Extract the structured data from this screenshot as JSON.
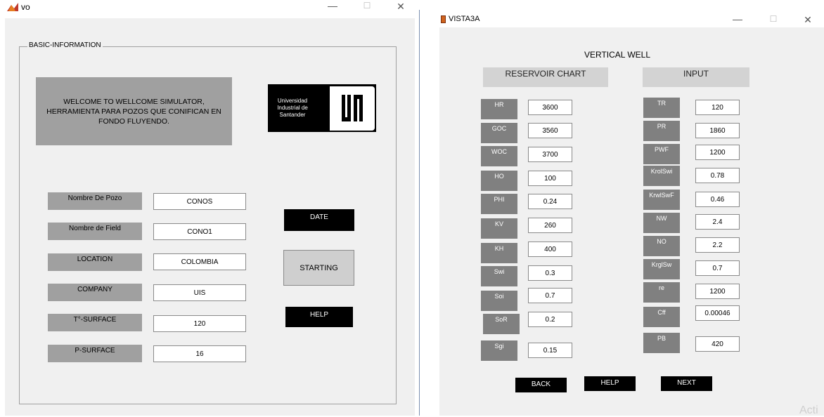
{
  "window1": {
    "title": "vo",
    "group_label": "BASIC-INFORMATION",
    "welcome_text": "WELCOME TO WELLCOME SIMULATOR, HERRAMIENTA PARA POZOS QUE CONIFICAN EN FONDO FLUYENDO.",
    "logo": {
      "line1": "Universidad",
      "line2": "Industrial de",
      "line3": "Santander"
    },
    "fields": [
      {
        "label": "Nombre De Pozo",
        "value": "CONOS"
      },
      {
        "label": "Nombre de Field",
        "value": "CONO1"
      },
      {
        "label": "LOCATION",
        "value": "COLOMBIA"
      },
      {
        "label": "COMPANY",
        "value": "UIS"
      },
      {
        "label": "T°-SURFACE",
        "value": "120"
      },
      {
        "label": "P-SURFACE",
        "value": "16"
      }
    ],
    "date_label": "DATE",
    "starting_label": "STARTING",
    "help_label": "HELP",
    "controls": {
      "minimize": "—",
      "maximize": "☐",
      "close": "✕"
    }
  },
  "window2": {
    "title": "VISTA3A",
    "heading": "VERTICAL WELL",
    "reservoir_header": "RESERVOIR CHART",
    "input_header": "INPUT",
    "reservoir": [
      {
        "label": "HR",
        "value": "3600"
      },
      {
        "label": "GOC",
        "value": "3560"
      },
      {
        "label": "WOC",
        "value": "3700"
      },
      {
        "label": "HO",
        "value": "100"
      },
      {
        "label": "PHI",
        "value": "0.24"
      },
      {
        "label": "KV",
        "value": "260"
      },
      {
        "label": "KH",
        "value": "400"
      },
      {
        "label": "Swi",
        "value": "0.3"
      },
      {
        "label": "Soi",
        "value": "0.7"
      },
      {
        "label": "SoR",
        "value": "0.2"
      },
      {
        "label": "Sgi",
        "value": "0.15"
      }
    ],
    "input": [
      {
        "label": "TR",
        "value": "120"
      },
      {
        "label": "PR",
        "value": "1860"
      },
      {
        "label": "PWF",
        "value": "1200"
      },
      {
        "label": "KrolSwi",
        "value": "0.78"
      },
      {
        "label": "KrwlSwF",
        "value": "0.46"
      },
      {
        "label": "NW",
        "value": "2.4"
      },
      {
        "label": "NO",
        "value": "2.2"
      },
      {
        "label": "KrglSw",
        "value": "0.7"
      },
      {
        "label": "re",
        "value": "1200"
      },
      {
        "label": "Cff",
        "value": "0.00046"
      },
      {
        "label": "PB",
        "value": "420"
      }
    ],
    "back_label": "BACK",
    "help_label": "HELP",
    "next_label": "NEXT",
    "controls": {
      "minimize": "—",
      "maximize": "☐",
      "close": "✕"
    }
  },
  "watermark": "Acti"
}
